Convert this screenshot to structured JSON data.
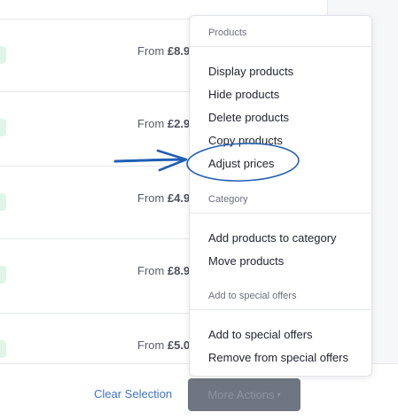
{
  "rows": [
    {
      "from_label": "From",
      "price": "£8.9"
    },
    {
      "from_label": "From",
      "price": "£2.9"
    },
    {
      "from_label": "From",
      "price": "£4.9"
    },
    {
      "from_label": "From",
      "price": "£8.9"
    },
    {
      "from_label": "From",
      "price": "£5.0"
    }
  ],
  "menu": {
    "products_title": "Products",
    "products_items": [
      "Display products",
      "Hide products",
      "Delete products",
      "Copy products",
      "Adjust prices"
    ],
    "category_title": "Category",
    "category_items": [
      "Add products to category",
      "Move products"
    ],
    "special_title": "Add to special offers",
    "special_items": [
      "Add to special offers",
      "Remove from special offers"
    ]
  },
  "footer": {
    "clear_selection": "Clear Selection",
    "more_actions": "More Actions",
    "more_actions_caret": "▾"
  },
  "annotation": {
    "color": "#1f5fb5",
    "highlighted_item": "Adjust prices"
  }
}
